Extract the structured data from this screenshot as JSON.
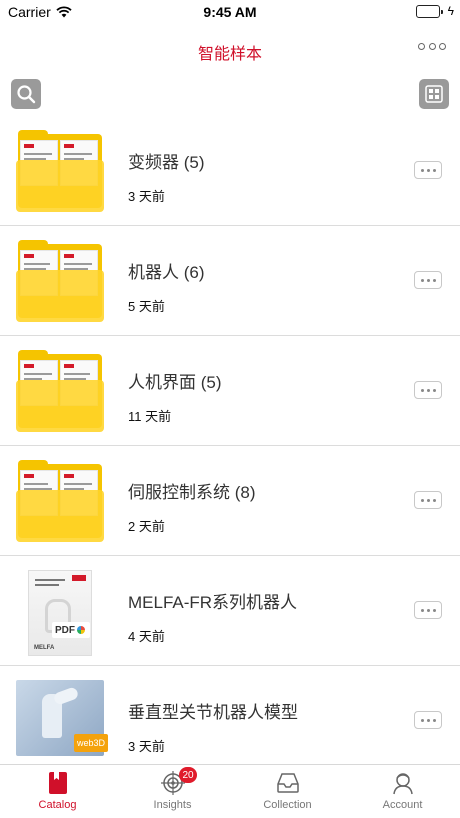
{
  "status_bar": {
    "carrier": "Carrier",
    "time": "9:45 AM"
  },
  "nav": {
    "title": "智能样本",
    "more_icon": "ellipsis-icon"
  },
  "toolbar": {
    "search_icon": "search-icon",
    "view_icon": "grid-view-icon"
  },
  "items": [
    {
      "title": "变频器 (5)",
      "date": "3 天前",
      "thumb": "folder"
    },
    {
      "title": "机器人 (6)",
      "date": "5 天前",
      "thumb": "folder"
    },
    {
      "title": "人机界面 (5)",
      "date": "11 天前",
      "thumb": "folder"
    },
    {
      "title": "伺服控制系统 (8)",
      "date": "2 天前",
      "thumb": "folder"
    },
    {
      "title": "MELFA-FR系列机器人",
      "date": "4 天前",
      "thumb": "pdf",
      "badge": "PDF"
    },
    {
      "title": "垂直型关节机器人模型",
      "date": "3 天前",
      "thumb": "web3d",
      "badge": "web3D"
    }
  ],
  "tabs": [
    {
      "label": "Catalog",
      "icon": "book-icon",
      "active": true
    },
    {
      "label": "Insights",
      "icon": "target-icon",
      "badge": "20"
    },
    {
      "label": "Collection",
      "icon": "inbox-icon"
    },
    {
      "label": "Account",
      "icon": "user-icon"
    }
  ],
  "colors": {
    "accent": "#d0102a",
    "folder": "#f5c400",
    "badge": "#e01b2b"
  }
}
